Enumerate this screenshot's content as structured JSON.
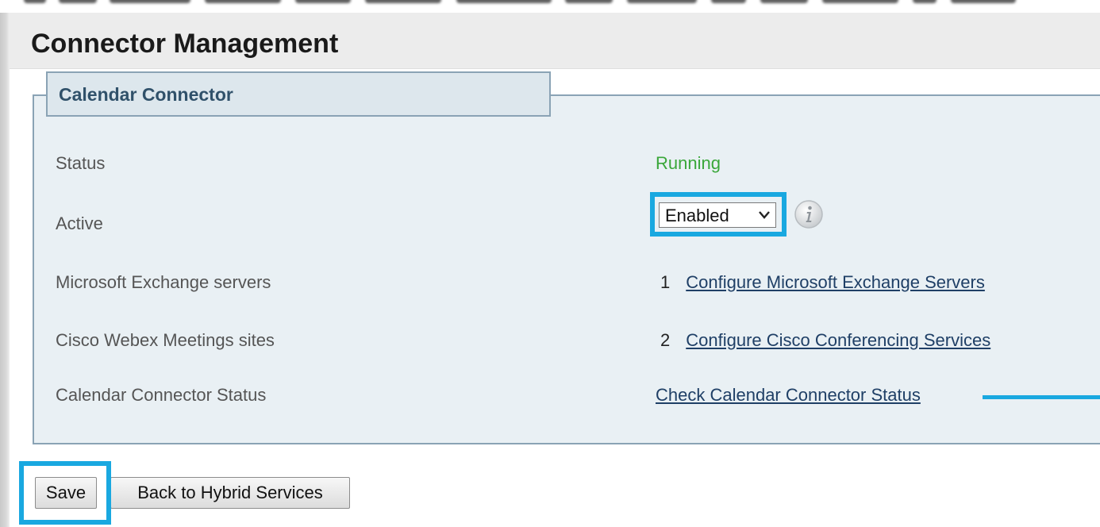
{
  "panel": {
    "title": "Connector Management"
  },
  "section": {
    "legend": "Calendar Connector"
  },
  "rows": {
    "status": {
      "label": "Status",
      "value": "Running",
      "value_color": "#3aa73a"
    },
    "active": {
      "label": "Active",
      "selected": "Enabled",
      "info_icon": "info-icon"
    },
    "exchange": {
      "label": "Microsoft Exchange servers",
      "count": "1",
      "link": "Configure Microsoft Exchange Servers"
    },
    "webex": {
      "label": "Cisco Webex Meetings sites",
      "count": "2",
      "link": "Configure Cisco Conferencing Services"
    },
    "connector_status": {
      "label": "Calendar Connector Status",
      "link": "Check Calendar Connector Status"
    }
  },
  "buttons": {
    "save": "Save",
    "back": "Back to Hybrid Services"
  },
  "colors": {
    "highlight": "#19a8e0",
    "link": "#1f3f66",
    "fieldset_bg": "#e9f0f4",
    "fieldset_border": "#8aa3b5"
  }
}
